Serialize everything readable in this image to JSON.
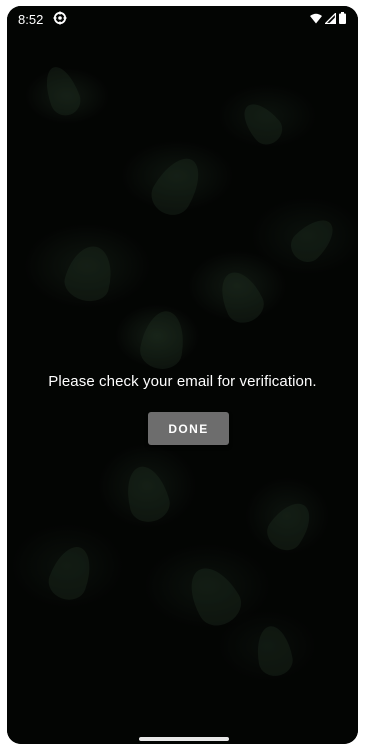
{
  "status_bar": {
    "time": "8:52",
    "icons": [
      "settings-gear-icon",
      "wifi-icon",
      "signal-icon",
      "battery-icon"
    ]
  },
  "dialog": {
    "message": "Please check your email for verification.",
    "done_label": "DONE"
  },
  "colors": {
    "background": "#050605",
    "button": "#6d6d6d",
    "text": "#ffffff"
  }
}
